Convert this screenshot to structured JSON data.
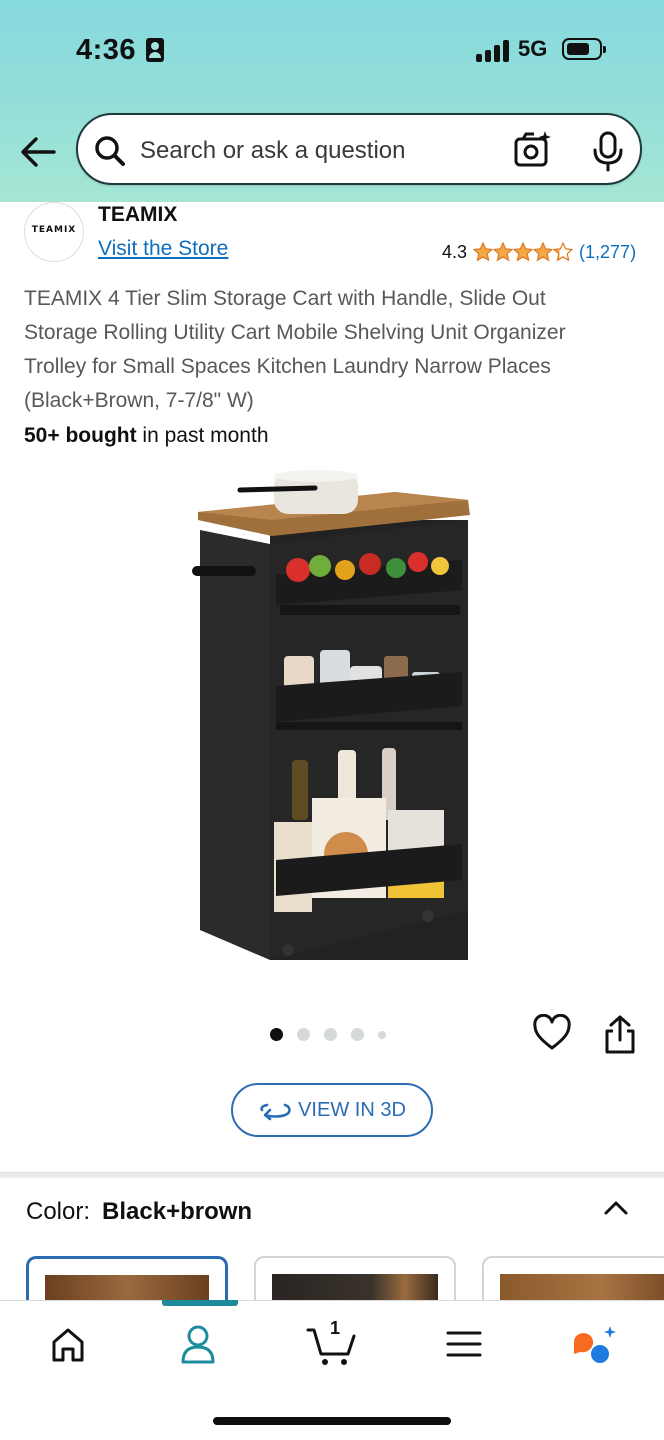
{
  "status_bar": {
    "time": "4:36",
    "network": "5G"
  },
  "search": {
    "placeholder": "Search or ask a question"
  },
  "brand": {
    "logo_text": "TEAMIX",
    "name": "TEAMIX",
    "visit_store": "Visit the Store",
    "rating": "4.3",
    "rating_count": "(1,277)",
    "stars_value": 4.3
  },
  "product": {
    "title": "TEAMIX 4 Tier Slim Storage Cart with Handle, Slide Out Storage Rolling Utility Cart Mobile Shelving Unit Organizer Trolley for Small Spaces Kitchen Laundry Narrow Places (Black+Brown, 7-7/8\" W)",
    "bought_bold": "50+ bought",
    "bought_rest": " in past month",
    "image_count": 5,
    "active_image": 1
  },
  "view3d": {
    "label": "VIEW IN 3D"
  },
  "color": {
    "label": "Color:",
    "value": "Black+brown"
  },
  "nav": {
    "items": [
      "home-icon",
      "account-icon",
      "cart-icon",
      "menu-icon",
      "rufus-icon"
    ],
    "cart_count": "1",
    "active": "account-icon"
  },
  "colors": {
    "accent": "#1c8b9c",
    "link": "#106ebe",
    "star": "#f3a847",
    "button_outline": "#2b6cb4"
  }
}
